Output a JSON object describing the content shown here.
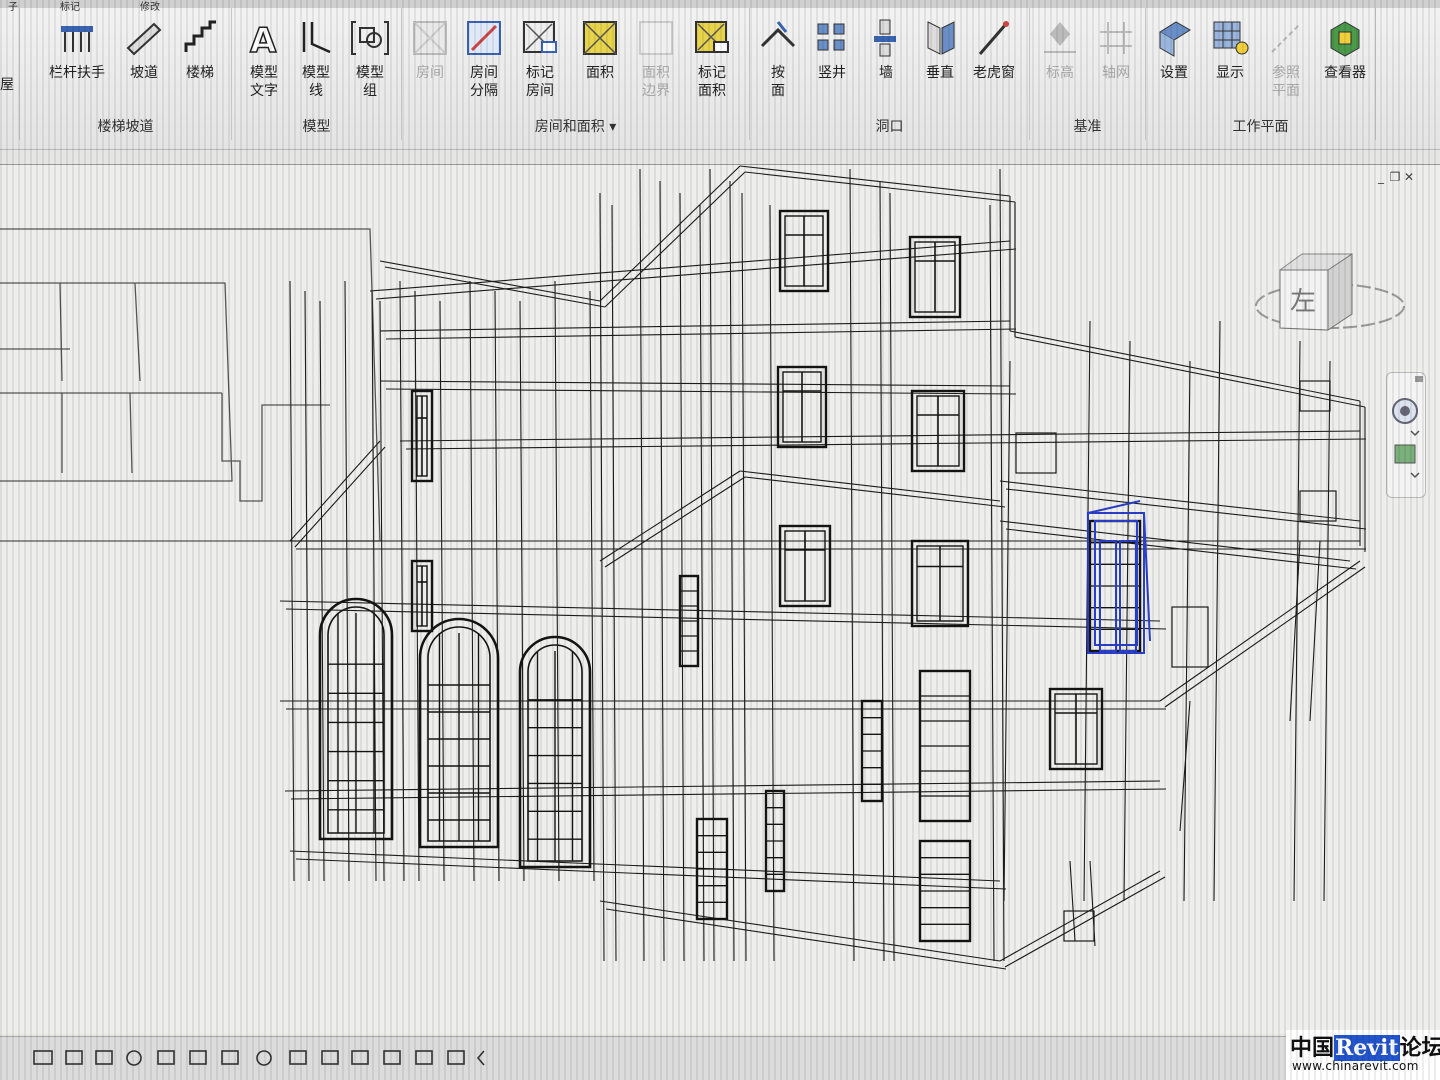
{
  "ribbon": {
    "top_tab_fragments": [
      "子",
      "标记",
      "修改"
    ],
    "left_edge_label": "屋",
    "panels": {
      "stairs": {
        "title": "楼梯坡道",
        "buttons": [
          {
            "label": "栏杆扶手",
            "icon": "railing-icon",
            "enabled": true
          },
          {
            "label": "坡道",
            "icon": "ramp-icon",
            "enabled": true
          },
          {
            "label": "楼梯",
            "icon": "stair-icon",
            "enabled": true
          }
        ]
      },
      "model": {
        "title": "模型",
        "buttons": [
          {
            "label": "模型\n文字",
            "icon": "model-text-icon",
            "enabled": true
          },
          {
            "label": "模型\n线",
            "icon": "model-line-icon",
            "enabled": true
          },
          {
            "label": "模型\n组",
            "icon": "model-group-icon",
            "enabled": true
          }
        ]
      },
      "room_area": {
        "title": "房间和面积",
        "buttons": [
          {
            "label": "房间",
            "icon": "room-icon",
            "enabled": false
          },
          {
            "label": "房间\n分隔",
            "icon": "room-separator-icon",
            "enabled": true
          },
          {
            "label": "标记\n房间",
            "icon": "tag-room-icon",
            "enabled": true
          },
          {
            "label": "面积",
            "icon": "area-icon",
            "enabled": true
          },
          {
            "label": "面积\n边界",
            "icon": "area-boundary-icon",
            "enabled": false
          },
          {
            "label": "标记\n面积",
            "icon": "tag-area-icon",
            "enabled": true
          }
        ]
      },
      "opening": {
        "title": "洞口",
        "buttons": [
          {
            "label": "按\n面",
            "icon": "by-face-icon",
            "enabled": true
          },
          {
            "label": "竖井",
            "icon": "shaft-icon",
            "enabled": true
          },
          {
            "label": "墙",
            "icon": "wall-opening-icon",
            "enabled": true
          },
          {
            "label": "垂直",
            "icon": "vertical-icon",
            "enabled": true
          },
          {
            "label": "老虎窗",
            "icon": "dormer-icon",
            "enabled": true
          }
        ]
      },
      "datum": {
        "title": "基准",
        "buttons": [
          {
            "label": "标高",
            "icon": "level-icon",
            "enabled": false
          },
          {
            "label": "轴网",
            "icon": "grid-icon",
            "enabled": false
          }
        ]
      },
      "work_plane": {
        "title": "工作平面",
        "buttons": [
          {
            "label": "设置",
            "icon": "set-plane-icon",
            "enabled": true
          },
          {
            "label": "显示",
            "icon": "show-plane-icon",
            "enabled": true
          },
          {
            "label": "参照\n平面",
            "icon": "ref-plane-icon",
            "enabled": false
          },
          {
            "label": "查看器",
            "icon": "viewer-icon",
            "enabled": true
          }
        ]
      }
    }
  },
  "viewport": {
    "controls": [
      "_",
      "❐",
      "✕"
    ],
    "viewcube_face": "左",
    "selected_element_color": "#2a3fc8"
  },
  "watermark": {
    "prefix": "中国",
    "brand": "Revit",
    "suffix": "论坛",
    "url": "www.chinarevit.com"
  },
  "colors": {
    "wire": "#1c1c1c",
    "highlight": "#2a3fc8",
    "ribbon_bg": "#ececec",
    "canvas_bg": "#eeeeec"
  }
}
